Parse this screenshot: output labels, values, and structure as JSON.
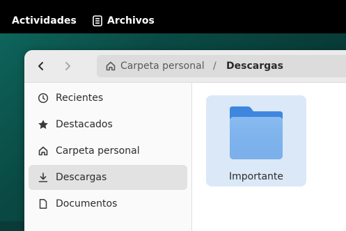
{
  "topbar": {
    "activities": "Actividades",
    "app_name": "Archivos",
    "app_icon": "files-app-icon"
  },
  "header": {
    "back_icon": "chevron-left-icon",
    "forward_icon": "chevron-right-icon",
    "breadcrumb": {
      "home_icon": "home-icon",
      "home_label": "Carpeta personal",
      "separator": "/",
      "current": "Descargas"
    }
  },
  "sidebar": {
    "items": [
      {
        "label": "Recientes",
        "icon": "clock-icon",
        "selected": false
      },
      {
        "label": "Destacados",
        "icon": "star-icon",
        "selected": false
      },
      {
        "label": "Carpeta personal",
        "icon": "home-icon",
        "selected": false
      },
      {
        "label": "Descargas",
        "icon": "download-icon",
        "selected": true
      },
      {
        "label": "Documentos",
        "icon": "document-icon",
        "selected": false
      }
    ]
  },
  "content": {
    "files": [
      {
        "name": "Importante",
        "icon": "folder-icon",
        "selected": true
      }
    ]
  },
  "colors": {
    "topbar": "#000000",
    "header": "#ebebeb",
    "selection": "#dbe8f7",
    "folder_blue": "#5a9be6"
  }
}
